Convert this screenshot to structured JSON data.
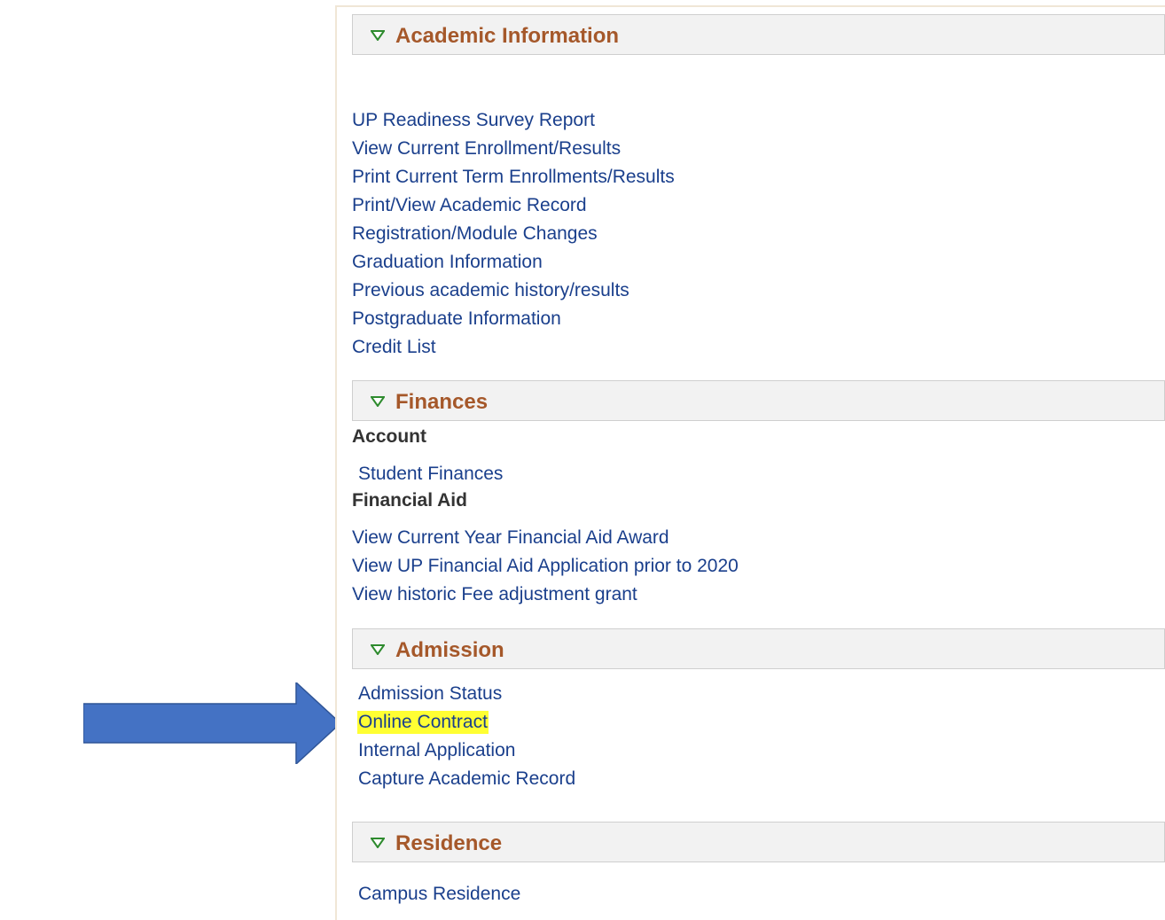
{
  "colors": {
    "header_text": "#a5582a",
    "link": "#1a3f8c",
    "highlight": "#ffff33",
    "arrow": "#4472c4"
  },
  "academic": {
    "title": "Academic Information",
    "links": [
      "UP Readiness Survey Report",
      "View Current Enrollment/Results",
      "Print Current Term Enrollments/Results",
      "Print/View Academic Record",
      "Registration/Module Changes",
      "Graduation Information",
      "Previous academic history/results",
      "Postgraduate Information",
      "Credit List"
    ]
  },
  "finances": {
    "title": "Finances",
    "account_label": "Account",
    "account_links": [
      "Student Finances"
    ],
    "aid_label": "Financial Aid",
    "aid_links": [
      "View Current Year Financial Aid Award",
      "View UP Financial Aid Application prior to 2020",
      "View historic Fee adjustment grant"
    ]
  },
  "admission": {
    "title": "Admission",
    "links": [
      "Admission Status",
      "Online Contract",
      "Internal Application",
      "Capture Academic Record"
    ]
  },
  "residence": {
    "title": "Residence",
    "links": [
      "Campus Residence"
    ]
  },
  "icons": {
    "section_toggle": "triangle-down-icon",
    "pointer": "arrow-right-icon"
  }
}
